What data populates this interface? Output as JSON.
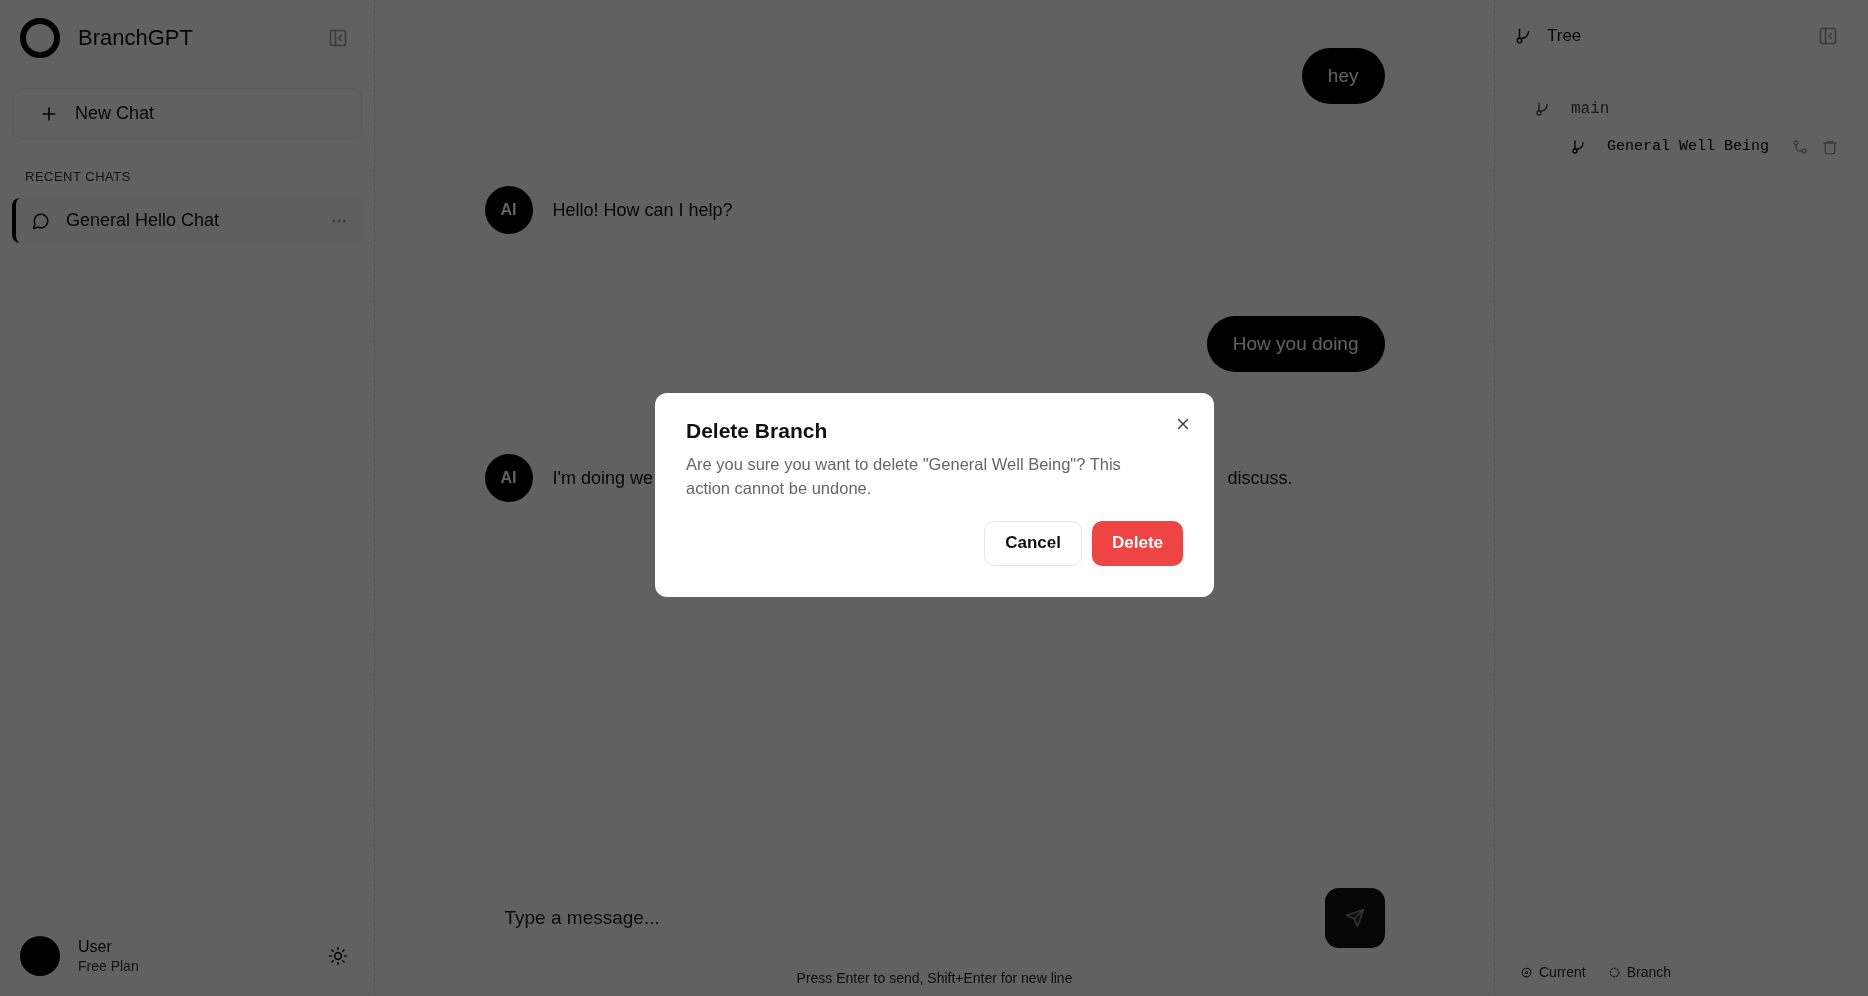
{
  "sidebar": {
    "brand": "BranchGPT",
    "new_chat": "New Chat",
    "section_label": "RECENT CHATS",
    "chats": [
      {
        "title": "General Hello Chat",
        "selected": true
      }
    ],
    "user": {
      "name": "User",
      "plan": "Free Plan"
    }
  },
  "chat": {
    "messages": [
      {
        "kind": "user",
        "text": "hey"
      },
      {
        "kind": "assistant",
        "avatar": "AI",
        "text": "Hello! How can I help?"
      },
      {
        "kind": "user",
        "text": "How you doing"
      },
      {
        "kind": "assistant",
        "avatar": "AI",
        "fragments": [
          "I'm doing we",
          "discuss."
        ]
      }
    ],
    "input": {
      "placeholder": "Type a message..."
    },
    "hint": "Press Enter to send, Shift+Enter for new line"
  },
  "tree_panel": {
    "title": "Tree",
    "branches": [
      {
        "name": "main",
        "current": false,
        "children": [
          {
            "name": "General Well Being",
            "current": true
          }
        ]
      }
    ],
    "legend": [
      {
        "label": "Current",
        "kind": "current"
      },
      {
        "label": "Branch",
        "kind": "branch"
      }
    ]
  },
  "dialog": {
    "title": "Delete Branch",
    "message": "Are you sure you want to delete \"General Well Being\"? This action cannot be undone.",
    "buttons": [
      {
        "label": "Cancel",
        "kind": "secondary"
      },
      {
        "label": "Delete",
        "kind": "danger"
      }
    ]
  }
}
